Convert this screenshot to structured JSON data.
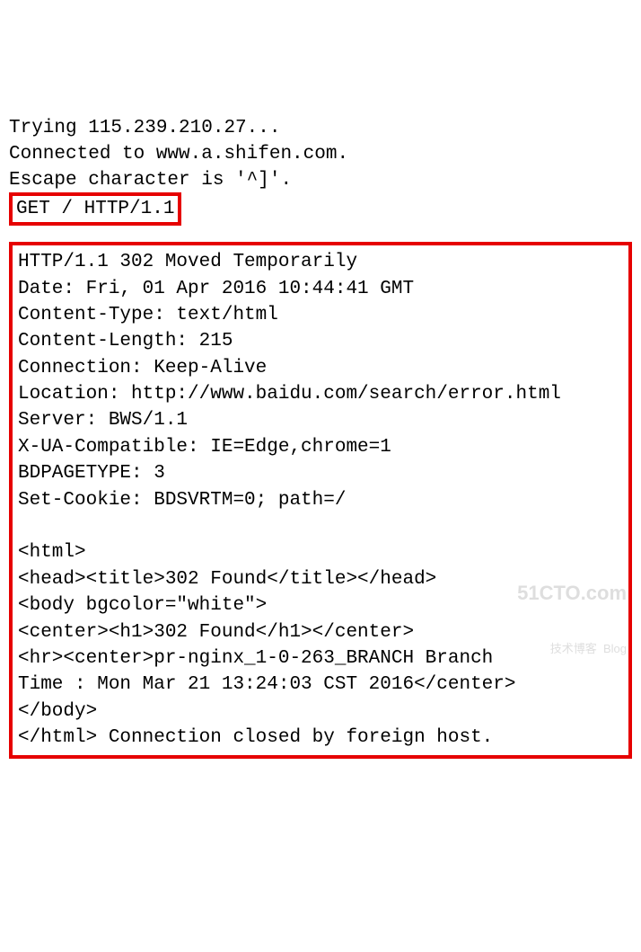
{
  "preamble": {
    "line1": "Trying 115.239.210.27...",
    "line2": "Connected to www.a.shifen.com.",
    "line3": "Escape character is '^]'."
  },
  "request": {
    "line": "GET / HTTP/1.1"
  },
  "response": {
    "status": "HTTP/1.1 302 Moved Temporarily",
    "date": "Date: Fri, 01 Apr 2016 10:44:41 GMT",
    "ctype": "Content-Type: text/html",
    "clen": "Content-Length: 215",
    "conn": "Connection: Keep-Alive",
    "loc": "Location: http://www.baidu.com/search/error.html",
    "server": "Server: BWS/1.1",
    "xua": "X-UA-Compatible: IE=Edge,chrome=1",
    "bdp": "BDPAGETYPE: 3",
    "cookie": "Set-Cookie: BDSVRTM=0; path=/",
    "body1": "<html>",
    "body2": "<head><title>302 Found</title></head>",
    "body3": "<body bgcolor=\"white\">",
    "body4": "<center><h1>302 Found</h1></center>",
    "body5": "<hr><center>pr-nginx_1-0-263_BRANCH Branch",
    "body6": "Time : Mon Mar 21 13:24:03 CST 2016</center>",
    "body7": "</body>",
    "body8": "</html> Connection closed by foreign host."
  },
  "watermark": {
    "main": "51CTO.com",
    "sub": "技术博客  Blog"
  }
}
